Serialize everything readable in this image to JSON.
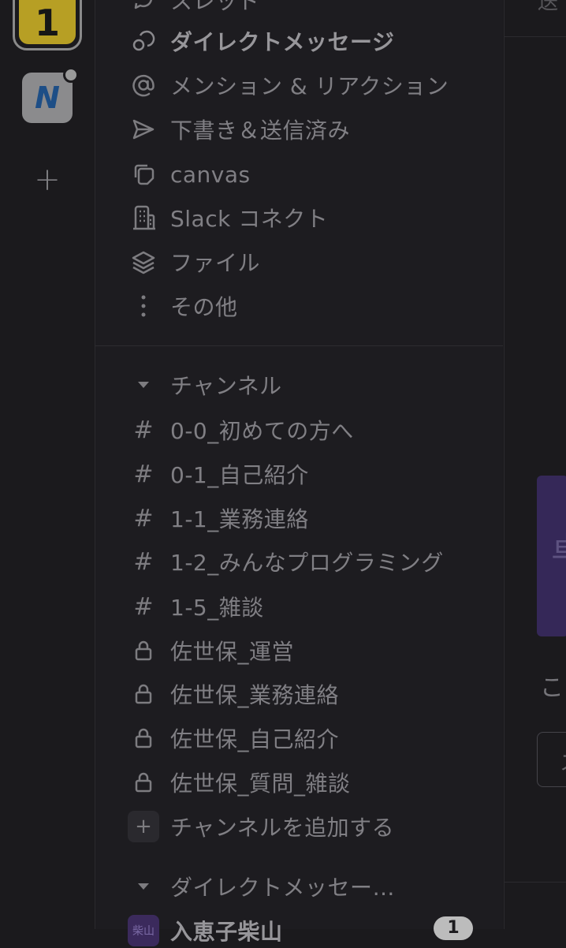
{
  "workspaces": {
    "ws1_initial": "1",
    "ws2_initial": "N",
    "add_label": "+"
  },
  "nav": {
    "threads": "スレッド",
    "dms": "ダイレクトメッセージ",
    "mentions": "メンション & リアクション",
    "drafts": "下書き＆送信済み",
    "canvas": "canvas",
    "connect": "Slack コネクト",
    "files": "ファイル",
    "more": "その他"
  },
  "channels": {
    "header": "チャンネル",
    "items": [
      {
        "type": "public",
        "name": "0-0_初めての方へ"
      },
      {
        "type": "public",
        "name": "0-1_自己紹介"
      },
      {
        "type": "public",
        "name": "1-1_業務連絡"
      },
      {
        "type": "public",
        "name": "1-2_みんなプログラミング"
      },
      {
        "type": "public",
        "name": "1-5_雑談"
      },
      {
        "type": "private",
        "name": "佐世保_運営"
      },
      {
        "type": "private",
        "name": "佐世保_業務連絡"
      },
      {
        "type": "private",
        "name": "佐世保_自己紹介"
      },
      {
        "type": "private",
        "name": "佐世保_質問_雑談"
      }
    ],
    "add_label": "チャンネルを追加する",
    "hash_symbol": "#"
  },
  "direct_messages": {
    "header": "ダイレクトメッセー…",
    "items": [
      {
        "name": "入恵子柴山",
        "avatar_text": "柴山",
        "badge": "1"
      }
    ]
  },
  "main": {
    "top_char": "送",
    "banner_char": "卓",
    "text_char": "こ",
    "box_char": "ス"
  },
  "colors": {
    "background": "#1b1a1d",
    "sidebar": "#1d1c20",
    "workspace_yellow": "#b79f24",
    "banner_purple": "#352858"
  }
}
